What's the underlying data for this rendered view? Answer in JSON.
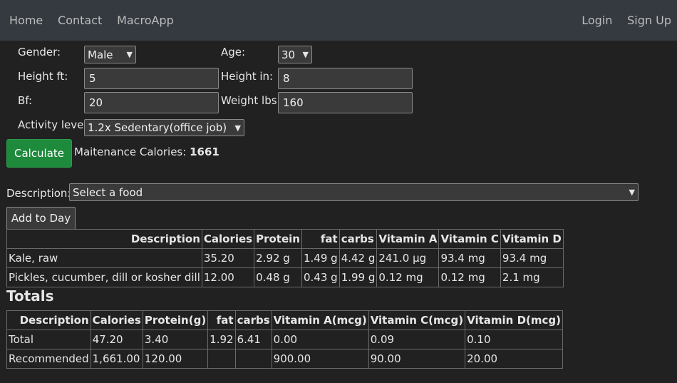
{
  "nav": {
    "left": [
      "Home",
      "Contact",
      "MacroApp"
    ],
    "right": [
      "Login",
      "Sign Up"
    ]
  },
  "form": {
    "gender_label": "Gender:",
    "gender_value": "Male",
    "age_label": "Age:",
    "age_value": "30",
    "height_ft_label": "Height ft:",
    "height_ft_value": "5",
    "height_in_label": "Height in:",
    "height_in_value": "8",
    "bf_label": "Bf:",
    "bf_value": "20",
    "weight_label": "Weight lbs:",
    "weight_value": "160",
    "activity_label": "Activity level:",
    "activity_value": "1.2x Sedentary(office job)",
    "calculate_label": "Calculate",
    "maintenance_label": "Maitenance Calories:",
    "maintenance_value": "1661"
  },
  "food": {
    "description_label": "Description:",
    "select_placeholder": "Select a food",
    "add_button": "Add to Day"
  },
  "food_table": {
    "headers": [
      "Description",
      "Calories",
      "Protein",
      "fat",
      "carbs",
      "Vitamin A",
      "Vitamin C",
      "Vitamin D"
    ],
    "rows": [
      [
        "Kale, raw",
        "35.20",
        "2.92 g",
        "1.49 g",
        "4.42 g",
        "241.0 µg",
        "93.4 mg",
        "93.4 mg"
      ],
      [
        "Pickles, cucumber, dill or kosher dill",
        "12.00",
        "0.48 g",
        "0.43 g",
        "1.99 g",
        "0.12 mg",
        "0.12 mg",
        "2.1 mg"
      ]
    ]
  },
  "totals": {
    "title": "Totals",
    "headers": [
      "Description",
      "Calories",
      "Protein(g)",
      "fat",
      "carbs",
      "Vitamin A(mcg)",
      "Vitamin C(mcg)",
      "Vitamin D(mcg)"
    ],
    "rows": [
      [
        "Total",
        "47.20",
        "3.40",
        "1.92",
        "6.41",
        "0.00",
        "0.09",
        "0.10"
      ],
      [
        "Recommended",
        "1,661.00",
        "120.00",
        "",
        "",
        "900.00",
        "90.00",
        "20.00"
      ]
    ]
  }
}
